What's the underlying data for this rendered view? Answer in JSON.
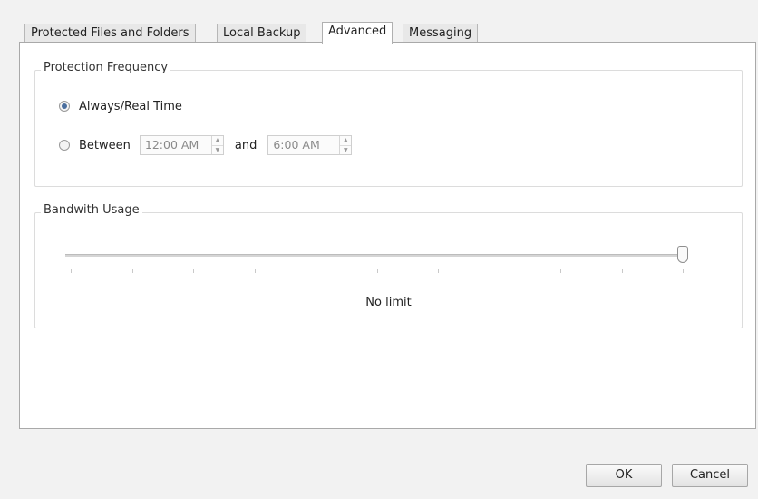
{
  "tabs": [
    {
      "label": "Protected Files and Folders",
      "active": false
    },
    {
      "label": "Local Backup",
      "active": false
    },
    {
      "label": "Advanced",
      "active": true
    },
    {
      "label": "Messaging",
      "active": false
    }
  ],
  "protection_frequency": {
    "legend": "Protection Frequency",
    "always_label": "Always/Real Time",
    "always_selected": true,
    "between_label": "Between",
    "between_selected": false,
    "start_time": "12:00 AM",
    "and_label": "and",
    "end_time": "6:00 AM"
  },
  "bandwidth": {
    "legend": "Bandwith Usage",
    "slider_fraction": 1.0,
    "tick_count": 11,
    "value_label": "No limit"
  },
  "buttons": {
    "ok_label": "OK",
    "cancel_label": "Cancel"
  },
  "colors": {
    "radio_selected": "#4a6e9e",
    "panel_border": "#a9a9a9"
  }
}
